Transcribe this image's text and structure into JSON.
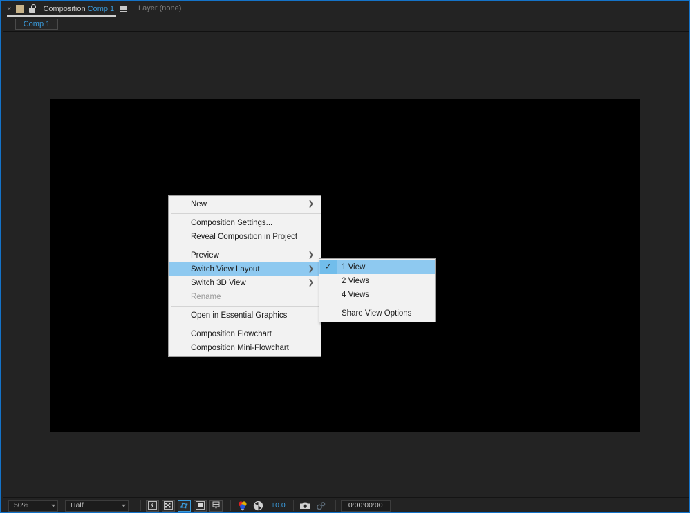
{
  "window": {
    "accent_color": "#1473c8",
    "panel_bg": "#232323",
    "canvas_color": "#000000"
  },
  "panel_header": {
    "close_label": "×",
    "title_prefix": "Composition",
    "comp_name": "Comp 1",
    "layer_label": "Layer  (none)"
  },
  "tabs": [
    {
      "label": "Comp 1",
      "active": true
    }
  ],
  "context_menu": {
    "highlight_color": "#8ec9f0",
    "items": [
      {
        "label": "New",
        "submenu": true,
        "separator_after": true
      },
      {
        "label": "Composition Settings...",
        "submenu": false
      },
      {
        "label": "Reveal Composition in Project",
        "submenu": false,
        "separator_after": true
      },
      {
        "label": "Preview",
        "submenu": true
      },
      {
        "label": "Switch View Layout",
        "submenu": true,
        "selected": true
      },
      {
        "label": "Switch 3D View",
        "submenu": true
      },
      {
        "label": "Rename",
        "submenu": false,
        "disabled": true,
        "separator_after": true
      },
      {
        "label": "Open in Essential Graphics",
        "submenu": false,
        "separator_after": true
      },
      {
        "label": "Composition Flowchart",
        "submenu": false
      },
      {
        "label": "Composition Mini-Flowchart",
        "submenu": false
      }
    ]
  },
  "submenu": {
    "parent": "Switch View Layout",
    "check_glyph": "✓",
    "items": [
      {
        "label": "1 View",
        "checked": true,
        "selected": true
      },
      {
        "label": "2 Views",
        "checked": false
      },
      {
        "label": "4 Views",
        "checked": false,
        "separator_after": true
      },
      {
        "label": "Share View Options",
        "checked": false
      }
    ]
  },
  "bottom_bar": {
    "zoom_level": "50%",
    "resolution": "Half",
    "exposure_value": "+0.0",
    "timecode": "0:00:00:00",
    "buttons": [
      {
        "name": "toggle-transparency-grid-icon",
        "active": false
      },
      {
        "name": "toggle-alpha-checkerboard-icon",
        "active": false
      },
      {
        "name": "toggle-mask-shape-paths-icon",
        "active": true
      },
      {
        "name": "toggle-title-action-safe-icon",
        "active": false
      },
      {
        "name": "toggle-3d-ground-plane-icon",
        "active": false
      },
      {
        "name": "channel-rgb-icon",
        "active": false
      },
      {
        "name": "exposure-icon",
        "active": false
      },
      {
        "name": "take-snapshot-icon",
        "active": false
      },
      {
        "name": "show-snapshot-icon",
        "active": false
      }
    ]
  }
}
